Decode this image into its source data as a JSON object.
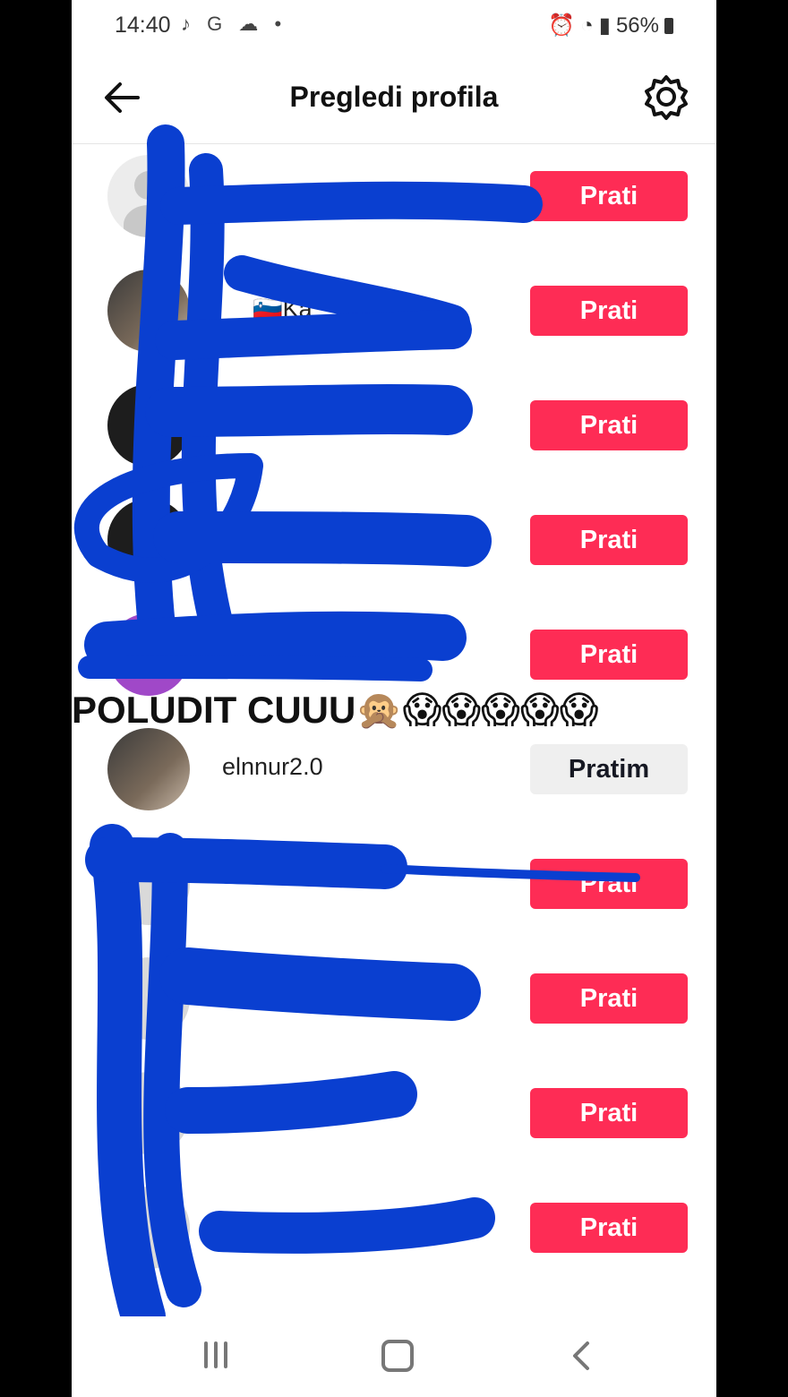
{
  "status_bar": {
    "time": "14:40",
    "left_icons": "♪ G ☁ •",
    "battery": "56%"
  },
  "header": {
    "title": "Pregledi profila"
  },
  "rows": [
    {
      "username": "",
      "button": "Prati",
      "following": false
    },
    {
      "username": "🇸🇮Ka",
      "button": "Prati",
      "following": false
    },
    {
      "username": "",
      "button": "Prati",
      "following": false
    },
    {
      "username": "",
      "button": "Prati",
      "following": false
    },
    {
      "username": "",
      "button": "Prati",
      "following": false
    },
    {
      "username": "elnnur2.0",
      "button": "Pratim",
      "following": true
    },
    {
      "username": "",
      "button": "Prati",
      "following": false
    },
    {
      "username": "",
      "button": "Prati",
      "following": false
    },
    {
      "username": "",
      "button": "Prati",
      "following": false
    },
    {
      "username": "",
      "button": "Prati",
      "following": false
    }
  ],
  "caption": "POLUDIT CUUU🙊😱😱😱😱😱",
  "scribble_color": "#0a3fd0",
  "accent": "#fe2c55"
}
